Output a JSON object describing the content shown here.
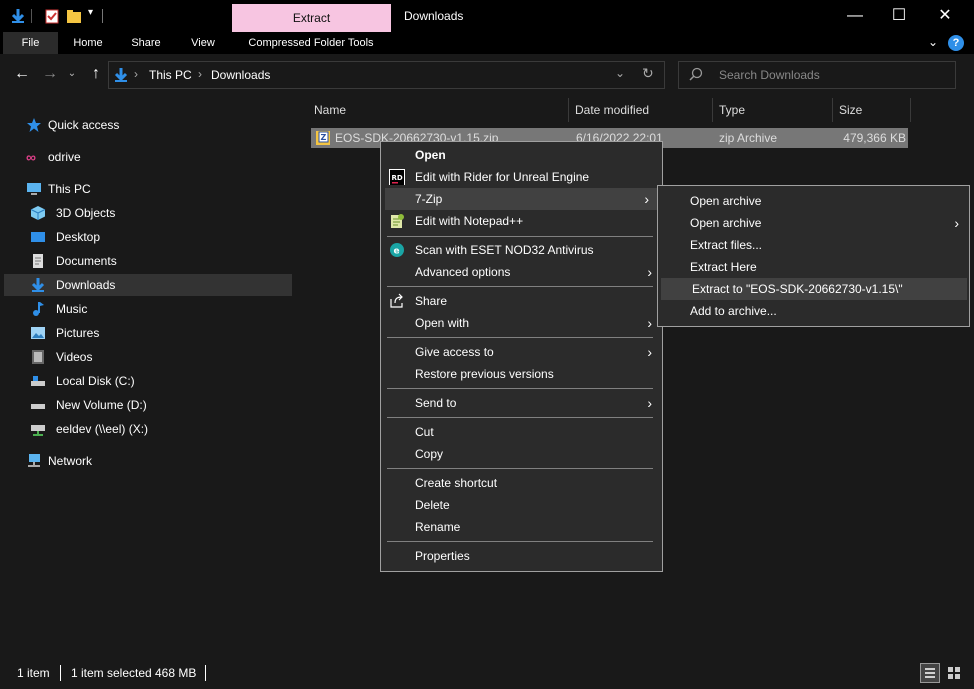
{
  "window": {
    "title": "Downloads",
    "context_tab": "Extract",
    "controls": {
      "minimize": "—",
      "maximize": "☐",
      "close": "✕"
    }
  },
  "ribbon": {
    "tabs": [
      "File",
      "Home",
      "Share",
      "View",
      "Compressed Folder Tools"
    ]
  },
  "address": {
    "breadcrumb": [
      "This PC",
      "Downloads"
    ],
    "search_placeholder": "Search Downloads"
  },
  "nav": {
    "quick_access": "Quick access",
    "odrive": "odrive",
    "this_pc": "This PC",
    "items": [
      "3D Objects",
      "Desktop",
      "Documents",
      "Downloads",
      "Music",
      "Pictures",
      "Videos",
      "Local Disk (C:)",
      "New Volume (D:)",
      "eeldev (\\\\eel) (X:)"
    ],
    "network": "Network"
  },
  "columns": {
    "name": "Name",
    "date": "Date modified",
    "type": "Type",
    "size": "Size"
  },
  "file": {
    "name": "EOS-SDK-20662730-v1.15.zip",
    "date": "6/16/2022 22:01",
    "type": "zip Archive",
    "size": "479,366 KB"
  },
  "status": {
    "count": "1 item",
    "selected": "1 item selected",
    "size": "468 MB"
  },
  "context_menu": {
    "open": "Open",
    "rider": "Edit with Rider for Unreal Engine",
    "sevenzip": "7-Zip",
    "notepad": "Edit with Notepad++",
    "eset": "Scan with ESET NOD32 Antivirus",
    "advanced": "Advanced options",
    "share": "Share",
    "open_with": "Open with",
    "give_access": "Give access to",
    "restore": "Restore previous versions",
    "send_to": "Send to",
    "cut": "Cut",
    "copy": "Copy",
    "create_shortcut": "Create shortcut",
    "delete": "Delete",
    "rename": "Rename",
    "properties": "Properties"
  },
  "submenu_7zip": {
    "open_archive": "Open archive",
    "open_archive_more": "Open archive",
    "extract_files": "Extract files...",
    "extract_here": "Extract Here",
    "extract_to": "Extract to \"EOS-SDK-20662730-v1.15\\\"",
    "add_to_archive": "Add to archive..."
  },
  "colors": {
    "background": "#191919",
    "titlebar": "#000000",
    "extract_tab": "#f7c5e1",
    "selection": "#777777",
    "menu_bg": "#2b2b2b",
    "menu_highlight": "#414141",
    "accent_blue": "#2f8fe8"
  }
}
